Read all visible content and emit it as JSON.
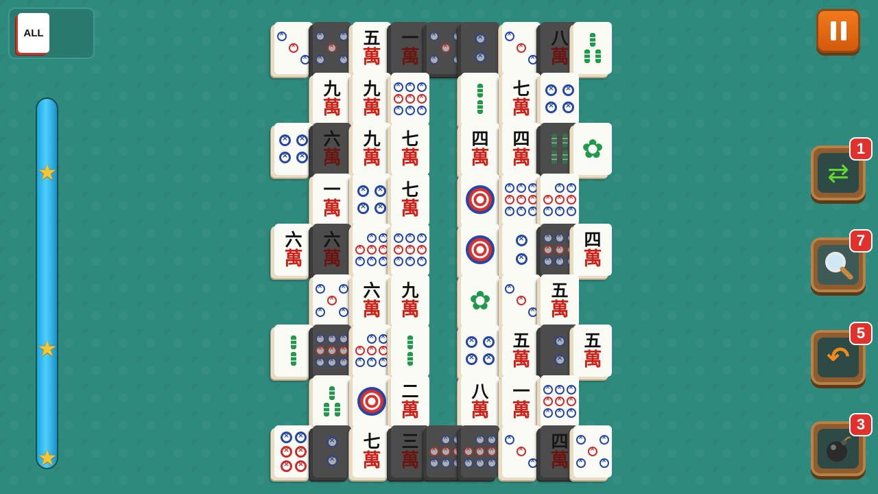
{
  "filter": {
    "label": "ALL"
  },
  "progress": {
    "fraction": 1.0,
    "stars": 3
  },
  "powerups": [
    {
      "name": "shuffle",
      "icon": "shuffle-icon",
      "count": "1"
    },
    {
      "name": "hint",
      "icon": "magnifier-icon",
      "count": "7"
    },
    {
      "name": "undo",
      "icon": "undo-icon",
      "count": "5"
    },
    {
      "name": "bomb",
      "icon": "bomb-icon",
      "count": "3"
    }
  ],
  "colors": {
    "felt": "#2f8a7e",
    "pause": "#f27a1b",
    "badge": "#e0312c",
    "progress": "#4fd0ff"
  },
  "tiles": [
    {
      "t": "dots",
      "v": "3d",
      "row": 0,
      "col": 0
    },
    {
      "t": "dots",
      "v": "5",
      "row": 0,
      "col": 1,
      "dark": true
    },
    {
      "t": "char",
      "top": "五",
      "row": 0,
      "col": 2
    },
    {
      "t": "char",
      "top": "一",
      "row": 0,
      "col": 3,
      "dark": true
    },
    {
      "t": "dots",
      "v": "5",
      "row": 0,
      "col": 4,
      "dark": true
    },
    {
      "t": "dots",
      "v": "2",
      "row": 0,
      "col": 5,
      "dark": true
    },
    {
      "t": "dots",
      "v": "3d",
      "row": 0,
      "col": 6
    },
    {
      "t": "char",
      "top": "八",
      "row": 0,
      "col": 7,
      "dark": true
    },
    {
      "t": "bam",
      "v": "3",
      "row": 0,
      "col": 8
    },
    {
      "t": "char",
      "top": "九",
      "row": 1,
      "col": 1
    },
    {
      "t": "char",
      "top": "九",
      "row": 1,
      "col": 2
    },
    {
      "t": "dots",
      "v": "7",
      "row": 1,
      "col": 3
    },
    {
      "t": "bam",
      "v": "2",
      "row": 1,
      "col": 5
    },
    {
      "t": "char",
      "top": "七",
      "row": 1,
      "col": 6
    },
    {
      "t": "dots",
      "v": "4",
      "row": 1,
      "col": 7
    },
    {
      "t": "dots",
      "v": "4",
      "row": 2,
      "col": 0
    },
    {
      "t": "char",
      "top": "六",
      "row": 2,
      "col": 1,
      "dark": true
    },
    {
      "t": "char",
      "top": "九",
      "row": 2,
      "col": 2
    },
    {
      "t": "char",
      "top": "七",
      "row": 2,
      "col": 3
    },
    {
      "t": "char",
      "top": "四",
      "row": 2,
      "col": 5
    },
    {
      "t": "char",
      "top": "四",
      "row": 2,
      "col": 6
    },
    {
      "t": "bam",
      "v": "4",
      "row": 2,
      "col": 7,
      "dark": true
    },
    {
      "t": "flower",
      "row": 2,
      "col": 8
    },
    {
      "t": "char",
      "top": "一",
      "row": 3,
      "col": 1
    },
    {
      "t": "dots",
      "v": "4",
      "row": 3,
      "col": 2
    },
    {
      "t": "char",
      "top": "七",
      "row": 3,
      "col": 3
    },
    {
      "t": "dots",
      "v": "1",
      "row": 3,
      "col": 5
    },
    {
      "t": "dots",
      "v": "9",
      "row": 3,
      "col": 6
    },
    {
      "t": "dots",
      "v": "8",
      "row": 3,
      "col": 7
    },
    {
      "t": "char",
      "top": "六",
      "row": 4,
      "col": 0
    },
    {
      "t": "char",
      "top": "六",
      "row": 4,
      "col": 1,
      "dark": true
    },
    {
      "t": "dots",
      "v": "8",
      "row": 4,
      "col": 2
    },
    {
      "t": "dots",
      "v": "9",
      "row": 4,
      "col": 3
    },
    {
      "t": "dots",
      "v": "1",
      "row": 4,
      "col": 5
    },
    {
      "t": "dots",
      "v": "2",
      "row": 4,
      "col": 6
    },
    {
      "t": "dots",
      "v": "7",
      "row": 4,
      "col": 7,
      "dark": true
    },
    {
      "t": "char",
      "top": "四",
      "row": 4,
      "col": 8
    },
    {
      "t": "dots",
      "v": "5",
      "row": 5,
      "col": 1
    },
    {
      "t": "char",
      "top": "六",
      "row": 5,
      "col": 2
    },
    {
      "t": "char",
      "top": "九",
      "row": 5,
      "col": 3
    },
    {
      "t": "flower",
      "row": 5,
      "col": 5
    },
    {
      "t": "dots",
      "v": "3d",
      "row": 5,
      "col": 6
    },
    {
      "t": "char",
      "top": "五",
      "row": 5,
      "col": 7
    },
    {
      "t": "bam",
      "v": "2",
      "row": 6,
      "col": 0
    },
    {
      "t": "dots",
      "v": "7",
      "row": 6,
      "col": 1,
      "dark": true
    },
    {
      "t": "dots",
      "v": "8",
      "row": 6,
      "col": 2
    },
    {
      "t": "bam",
      "v": "2",
      "row": 6,
      "col": 3
    },
    {
      "t": "dots",
      "v": "4",
      "row": 6,
      "col": 5
    },
    {
      "t": "char",
      "top": "五",
      "row": 6,
      "col": 6
    },
    {
      "t": "dots",
      "v": "2",
      "row": 6,
      "col": 7,
      "dark": true
    },
    {
      "t": "char",
      "top": "五",
      "row": 6,
      "col": 8
    },
    {
      "t": "bam",
      "v": "3",
      "row": 7,
      "col": 1
    },
    {
      "t": "dots",
      "v": "1",
      "row": 7,
      "col": 2
    },
    {
      "t": "char",
      "top": "二",
      "row": 7,
      "col": 3
    },
    {
      "t": "char",
      "top": "八",
      "row": 7,
      "col": 5
    },
    {
      "t": "char",
      "top": "一",
      "row": 7,
      "col": 6
    },
    {
      "t": "dots",
      "v": "9",
      "row": 7,
      "col": 7
    },
    {
      "t": "dots",
      "v": "6",
      "row": 8,
      "col": 0
    },
    {
      "t": "dots",
      "v": "2",
      "row": 8,
      "col": 1,
      "dark": true
    },
    {
      "t": "char",
      "top": "七",
      "row": 8,
      "col": 2
    },
    {
      "t": "char",
      "top": "三",
      "row": 8,
      "col": 3,
      "dark": true
    },
    {
      "t": "dots",
      "v": "8",
      "row": 8,
      "col": 4,
      "dark": true
    },
    {
      "t": "dots",
      "v": "8",
      "row": 8,
      "col": 5,
      "dark": true
    },
    {
      "t": "dots",
      "v": "3d",
      "row": 8,
      "col": 6
    },
    {
      "t": "char",
      "top": "四",
      "row": 8,
      "col": 7,
      "dark": true
    },
    {
      "t": "dots",
      "v": "5",
      "row": 8,
      "col": 8
    }
  ],
  "char_suit": "萬"
}
